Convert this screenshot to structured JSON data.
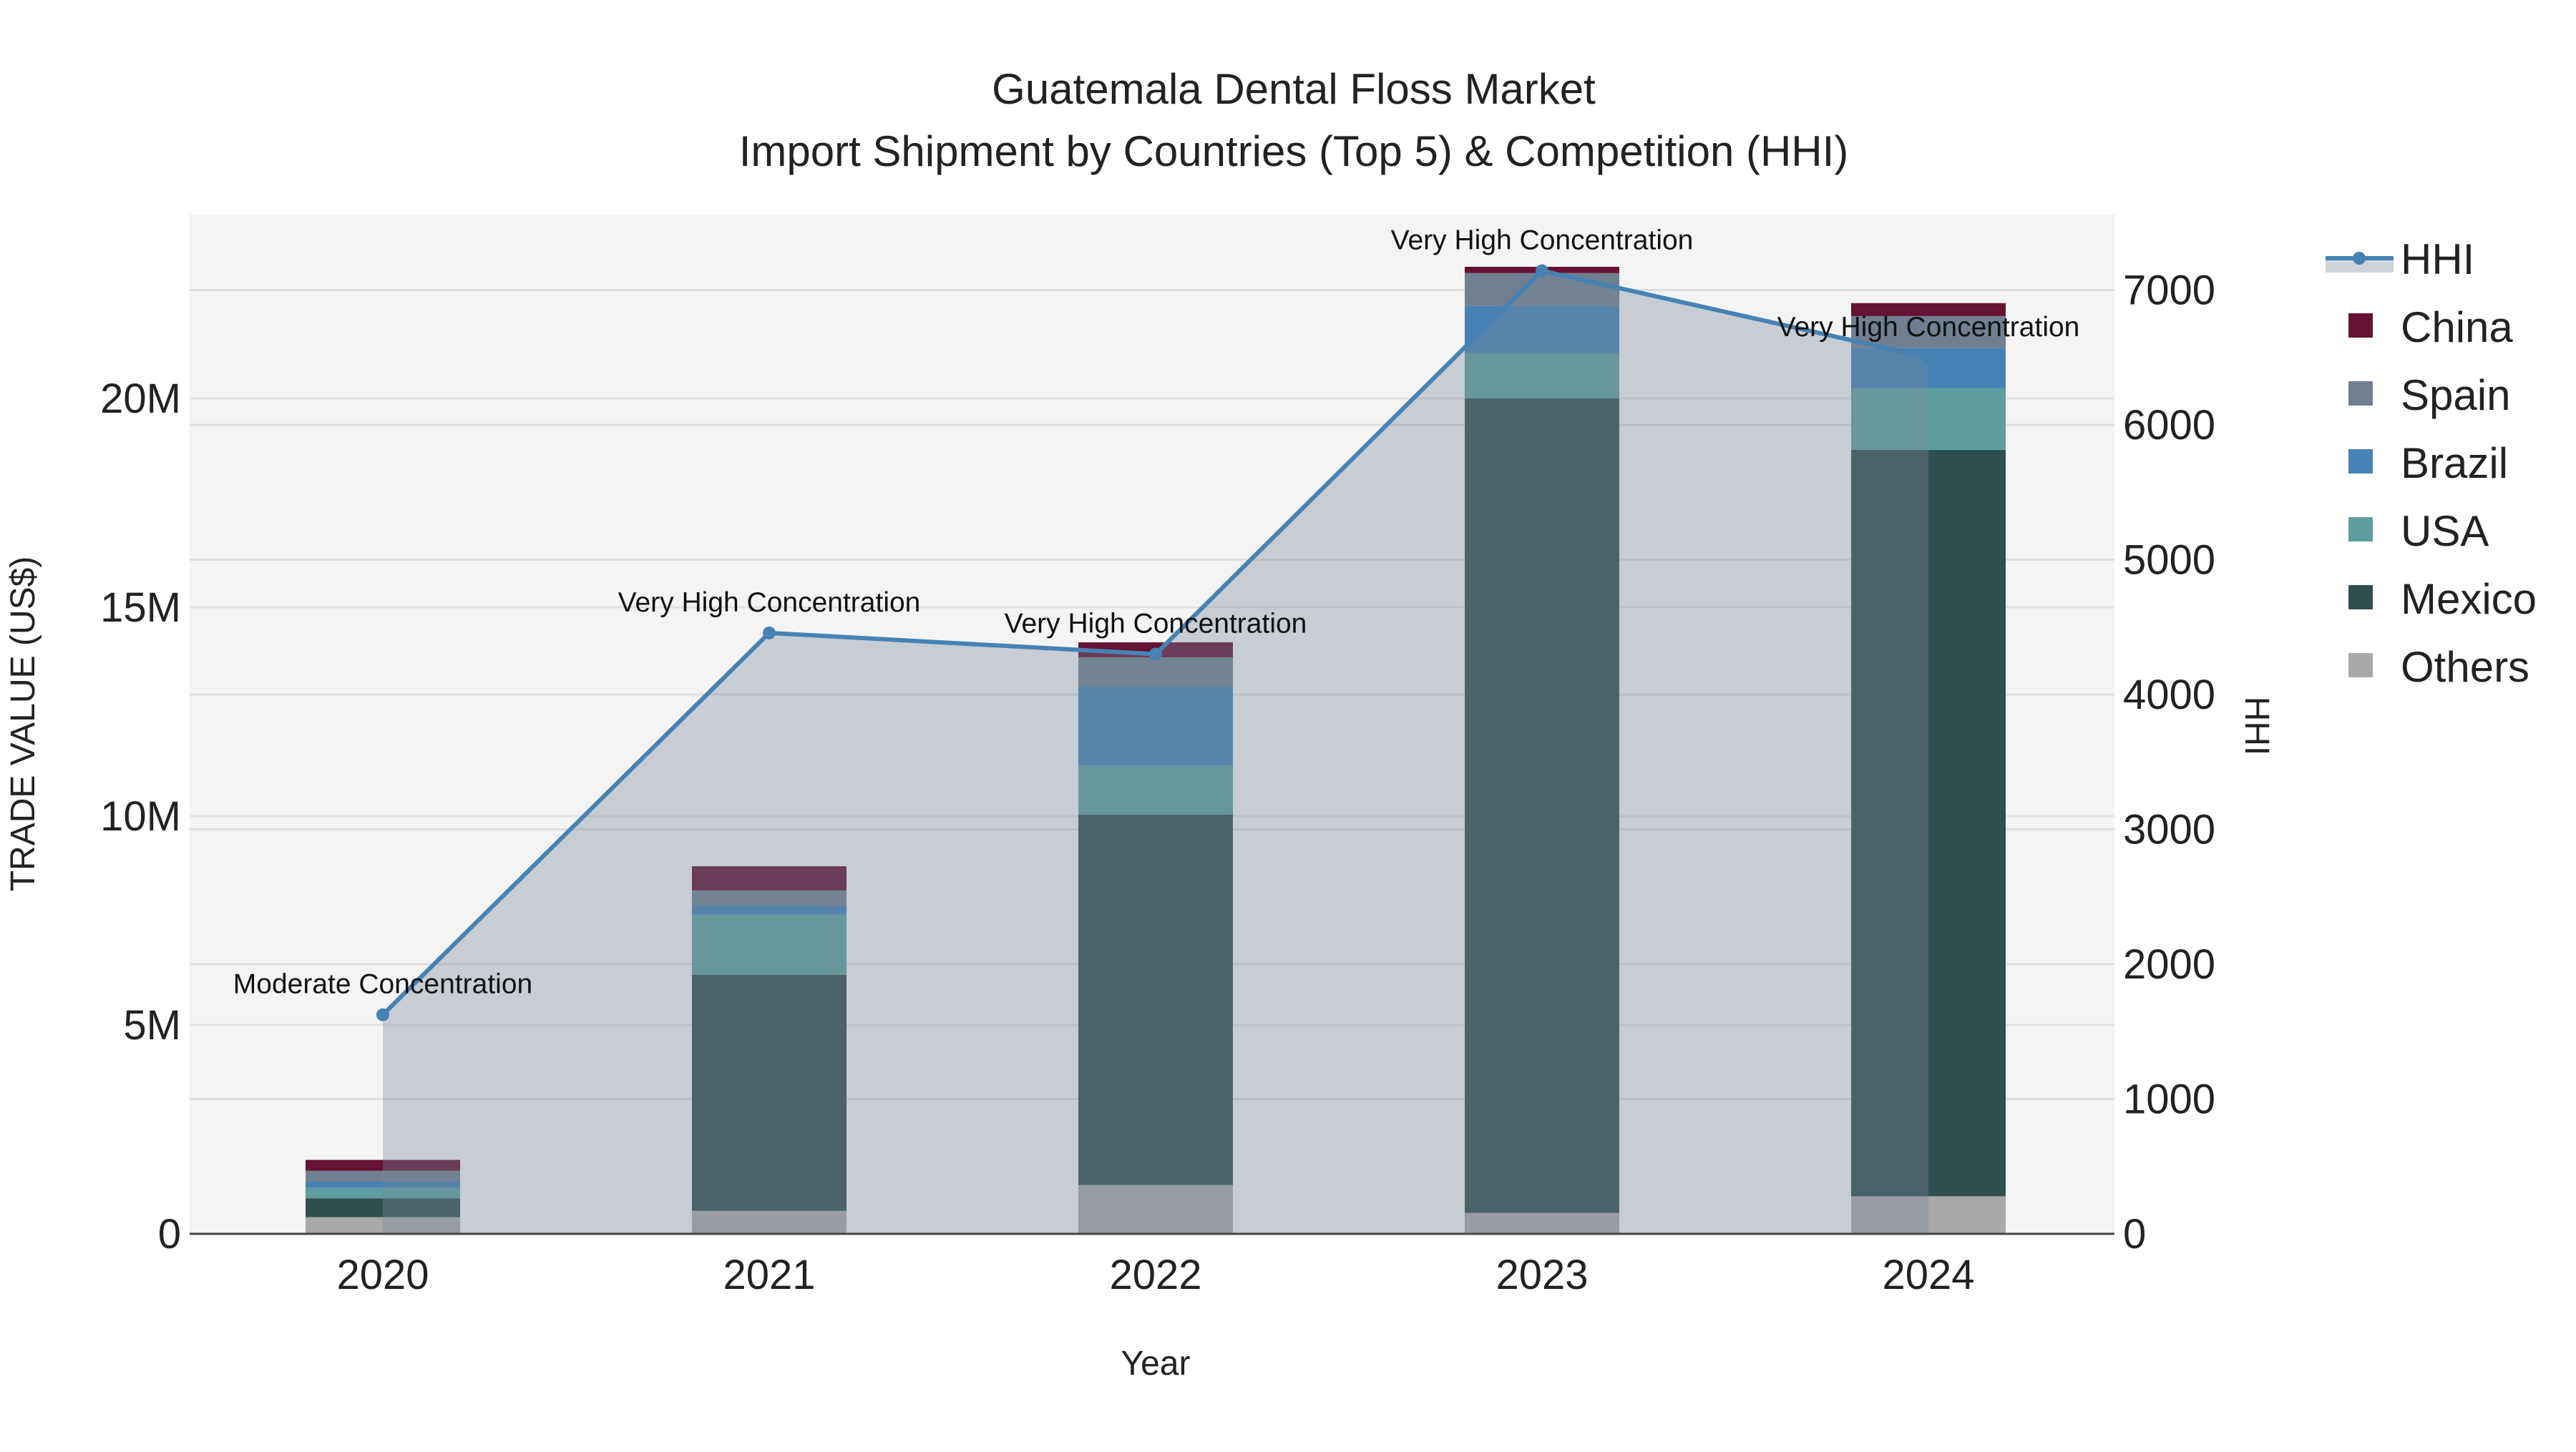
{
  "chart_data": {
    "type": "bar",
    "title": "Guatemala Dental Floss Market",
    "subtitle": "Import Shipment by Countries (Top 5) & Competition (HHI)",
    "xlabel": "Year",
    "ylabel": "TRADE VALUE (US$)",
    "y2label": "HHI",
    "categories": [
      "2020",
      "2021",
      "2022",
      "2023",
      "2024"
    ],
    "ylim": [
      0,
      24400000
    ],
    "y2lim": [
      0,
      7560
    ],
    "yticks": [
      0,
      5000000,
      10000000,
      15000000,
      20000000
    ],
    "ytick_labels": [
      "0",
      "5M",
      "10M",
      "15M",
      "20M"
    ],
    "y2ticks": [
      0,
      1000,
      2000,
      3000,
      4000,
      5000,
      6000,
      7000
    ],
    "y2tick_labels": [
      "0",
      "1000",
      "2000",
      "3000",
      "4000",
      "5000",
      "6000",
      "7000"
    ],
    "grid": true,
    "legend_position": "right",
    "series": [
      {
        "name": "Others",
        "color": "#a9a9a9",
        "values": [
          400000,
          550000,
          1170000,
          500000,
          900000
        ]
      },
      {
        "name": "Mexico",
        "color": "#2f4f4f",
        "values": [
          450000,
          5650000,
          8870000,
          19500000,
          17870000
        ]
      },
      {
        "name": "USA",
        "color": "#5f9ea0",
        "values": [
          250000,
          1440000,
          1170000,
          1080000,
          1470000
        ]
      },
      {
        "name": "Brazil",
        "color": "#4682b4",
        "values": [
          150000,
          220000,
          1890000,
          1130000,
          960000
        ]
      },
      {
        "name": "Spain",
        "color": "#708090",
        "values": [
          260000,
          360000,
          700000,
          790000,
          770000
        ]
      },
      {
        "name": "China",
        "color": "#651233",
        "values": [
          260000,
          580000,
          360000,
          150000,
          310000
        ]
      }
    ],
    "hhi": {
      "name": "HHI",
      "color": "#4682b4",
      "area_color": "#778899",
      "values": [
        1625,
        4457,
        4300,
        7143,
        6500
      ],
      "annotations": [
        "Moderate Concentration",
        "Very High Concentration",
        "Very High Concentration",
        "Very High Concentration",
        "Very High Concentration"
      ]
    },
    "legend": [
      "HHI",
      "China",
      "Spain",
      "Brazil",
      "USA",
      "Mexico",
      "Others"
    ]
  }
}
